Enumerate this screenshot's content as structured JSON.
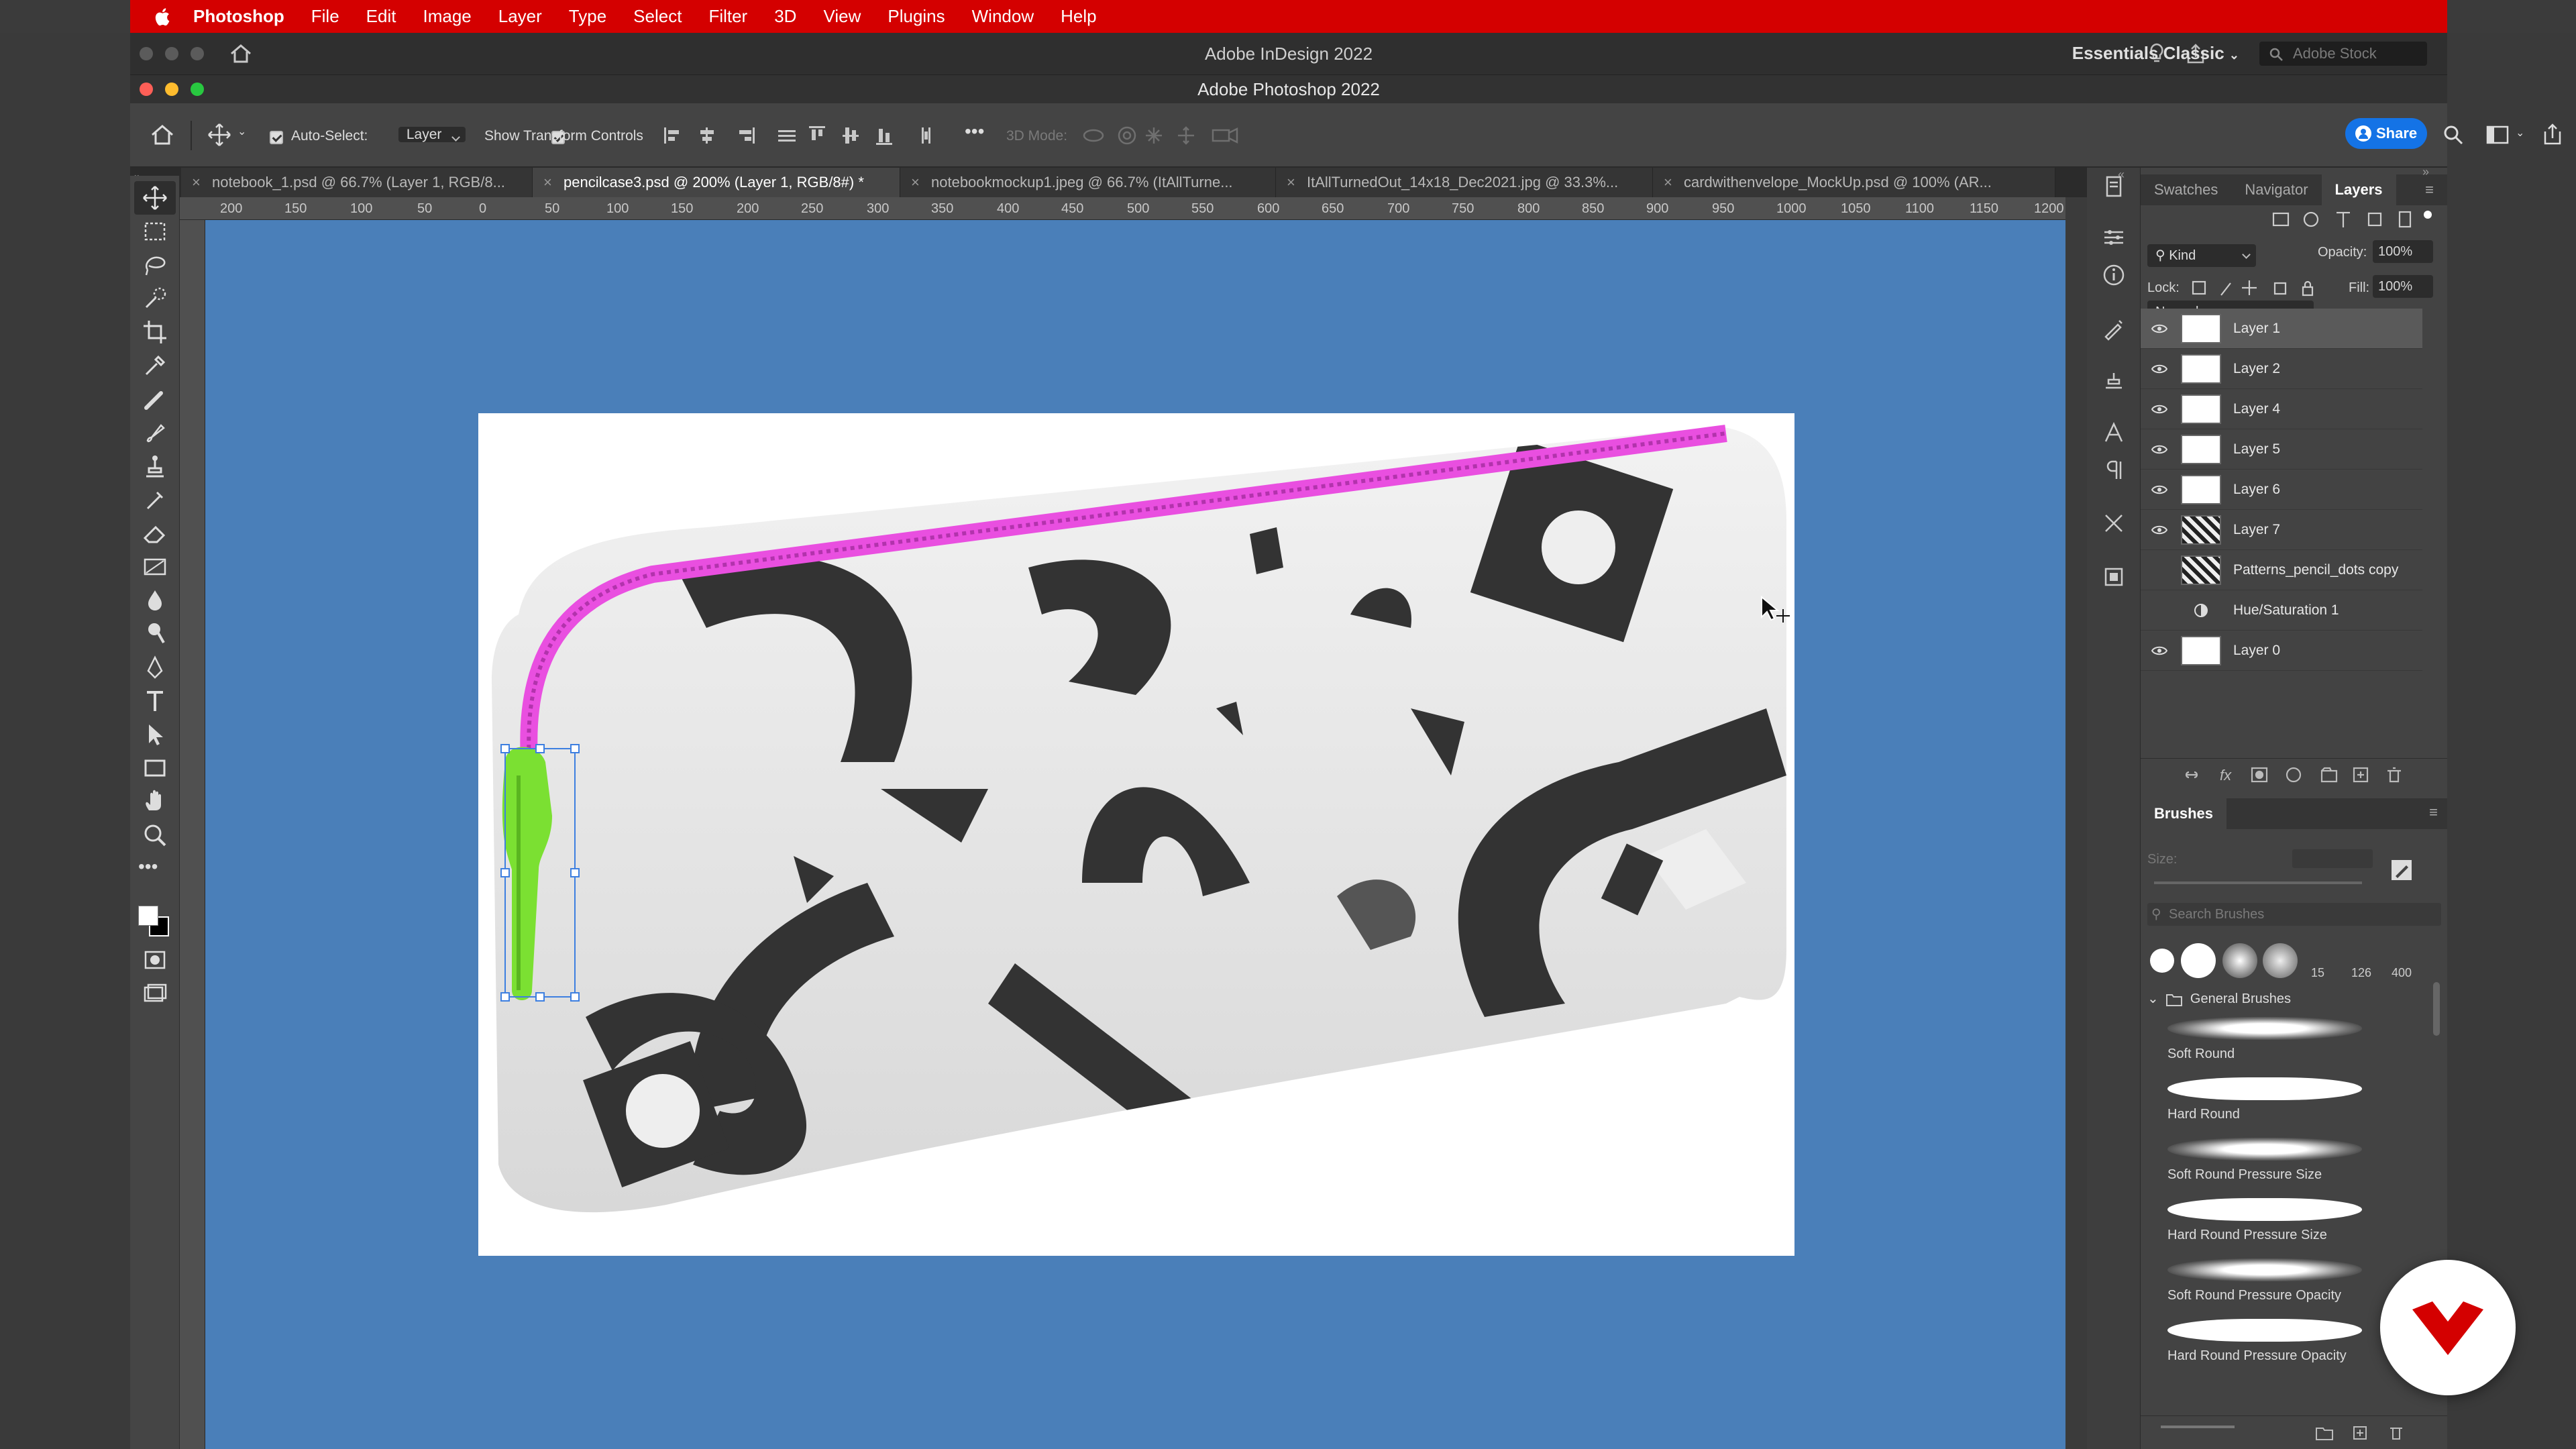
{
  "menubar": {
    "app_name": "Photoshop",
    "items": [
      "File",
      "Edit",
      "Image",
      "Layer",
      "Type",
      "Select",
      "Filter",
      "3D",
      "View",
      "Plugins",
      "Window",
      "Help"
    ],
    "color": "#d40000"
  },
  "indesign_window": {
    "title": "Adobe InDesign 2022",
    "workspace": "Essentials Classic",
    "stock_placeholder": "Adobe Stock"
  },
  "photoshop_window": {
    "title": "Adobe Photoshop 2022"
  },
  "options": {
    "auto_select_label": "Auto-Select:",
    "auto_select_value": "Layer",
    "transform_label": "Show Transform Controls",
    "mode_3d_label": "3D Mode:",
    "share_label": "Share"
  },
  "doc_tabs": [
    {
      "label": "notebook_1.psd @ 66.7% (Layer 1, RGB/8...",
      "active": false
    },
    {
      "label": "pencilcase3.psd @ 200% (Layer 1, RGB/8#) *",
      "active": true
    },
    {
      "label": "notebookmockup1.jpeg @ 66.7% (ItAllTurne...",
      "active": false
    },
    {
      "label": "ItAllTurnedOut_14x18_Dec2021.jpg @ 33.3%...",
      "active": false
    },
    {
      "label": "cardwithenvelope_MockUp.psd @ 100% (AR...",
      "active": false
    }
  ],
  "ruler": {
    "h_ticks": [
      "200",
      "150",
      "100",
      "50",
      "0",
      "50",
      "100",
      "150",
      "200",
      "250",
      "300",
      "350",
      "400",
      "450",
      "500",
      "550",
      "600",
      "650",
      "700",
      "750",
      "800",
      "850",
      "900",
      "950",
      "1000",
      "1050",
      "1100",
      "1150",
      "1200"
    ],
    "v_ticks": [
      "1 5 0",
      "1 0 0",
      "5 0",
      "0",
      "5 0",
      "1 0 0",
      "1 5 0",
      "2 0 0",
      "2 5 0",
      "3 0 0",
      "3 5 0",
      "4 0 0",
      "4 5 0",
      "5 0 0",
      "5 5 0",
      "6 0 0",
      "6 5 0",
      "7 0 0"
    ]
  },
  "panels": {
    "tabs": [
      "Swatches",
      "Navigator",
      "Layers"
    ],
    "filter_kind": "Kind",
    "blend_mode": "Normal",
    "opacity_label": "Opacity:",
    "opacity_value": "100%",
    "lock_label": "Lock:",
    "fill_label": "Fill:",
    "fill_value": "100%",
    "layers": [
      {
        "name": "Layer 1",
        "visible": true,
        "selected": true
      },
      {
        "name": "Layer 2",
        "visible": true
      },
      {
        "name": "Layer 4",
        "visible": true
      },
      {
        "name": "Layer 5",
        "visible": true
      },
      {
        "name": "Layer 6",
        "visible": true
      },
      {
        "name": "Layer 7",
        "visible": true
      },
      {
        "name": "Patterns_pencil_dots copy",
        "visible": false
      },
      {
        "name": "Hue/Saturation 1",
        "visible": false
      },
      {
        "name": "Layer 0",
        "visible": true
      }
    ]
  },
  "brushes": {
    "title": "Brushes",
    "size_label": "Size:",
    "search_placeholder": "Search Brushes",
    "presets": [
      "15",
      "126",
      "400"
    ],
    "group": "General Brushes",
    "items": [
      "Soft Round",
      "Hard Round",
      "Soft Round Pressure Size",
      "Hard Round Pressure Size",
      "Soft Round Pressure Opacity",
      "Hard Round Pressure Opacity"
    ]
  }
}
